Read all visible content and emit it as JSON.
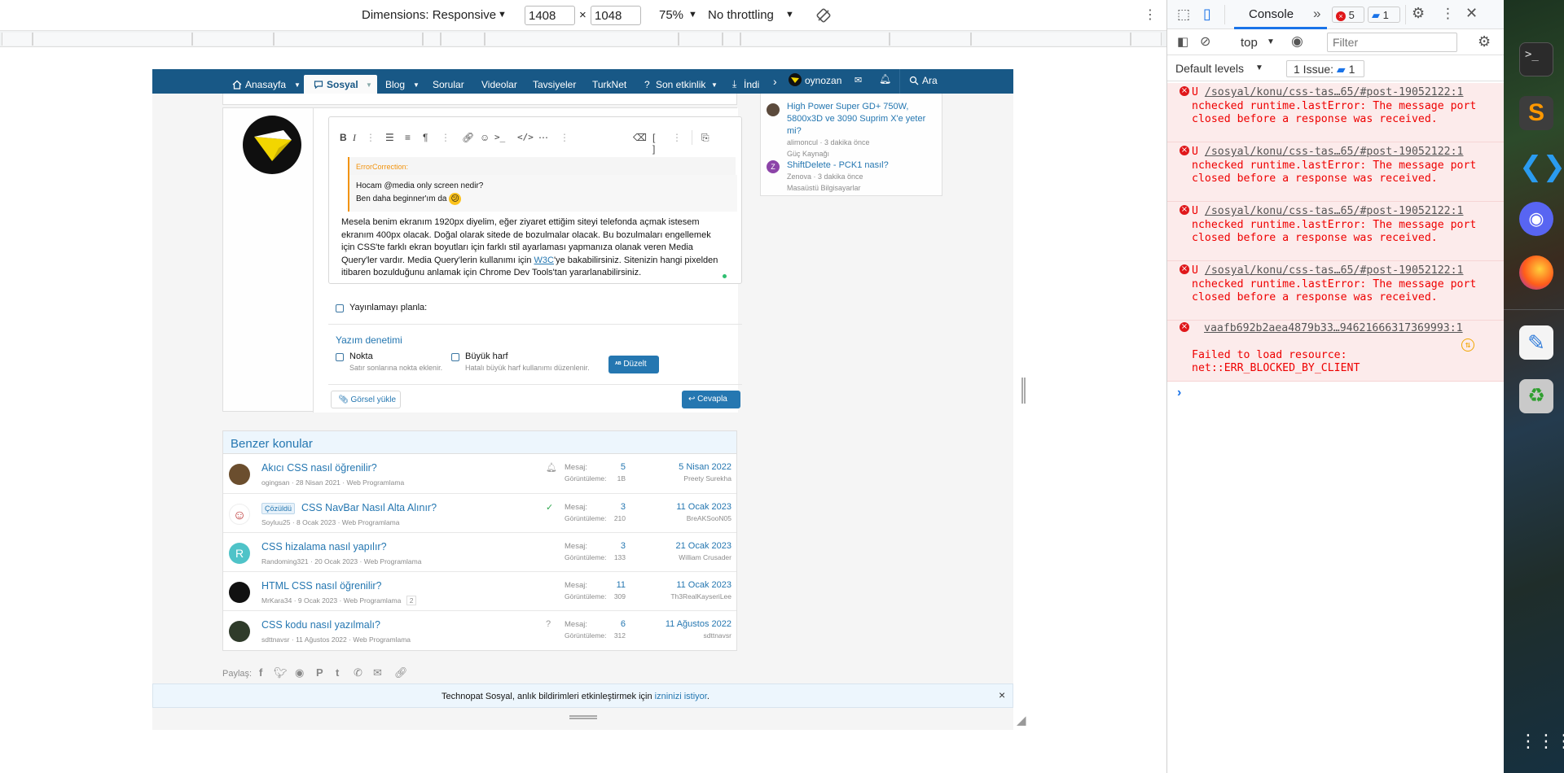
{
  "device_toolbar": {
    "dimensions_label": "Dimensions: Responsive",
    "width": "1408",
    "height": "1048",
    "times": "×",
    "zoom": "75%",
    "throttling": "No throttling"
  },
  "site_nav": {
    "items": [
      "Anasayfa",
      "Sosyal",
      "Blog",
      "Sorular",
      "Videolar",
      "Tavsiyeler",
      "TurkNet",
      "Son etkinlik",
      "İndir"
    ],
    "user": "oynozan",
    "search": "Ara"
  },
  "sidebar_threads": [
    {
      "title": "High Power Super GD+ 750W, 5800x3D ve 3090 Suprim X'e yeter mi?",
      "meta": "alimoncul · 3 dakika önce",
      "forum": "Güç Kaynağı"
    },
    {
      "title": "ShiftDelete - PCK1 nasıl?",
      "meta": "Zenova · 3 dakika önce",
      "forum": "Masaüstü Bilgisayarlar",
      "avatar_letter": "Z"
    }
  ],
  "editor": {
    "quote_author": "ErrorCorrection:",
    "quote_line1": "Hocam @media only screen nedir?",
    "quote_line2": "Ben daha beginner'ım da",
    "body_line1": "Mesela benim ekranım 1920px diyelim, eğer ziyaret ettiğim siteyi telefonda açmak istesem",
    "body_line2": "ekranım 400px olacak. Doğal olarak sitede de bozulmalar olacak. Bu bozulmaları engellemek",
    "body_line3": "için CSS'te farklı ekran boyutları için farklı stil ayarlaması yapmanıza olanak veren Media",
    "body_line4a": "Query'ler vardır. Media Query'lerin kullanımı için ",
    "body_line4_link": "W3C",
    "body_line4b": "'ye bakabilirsiniz. Sitenizin hangi pixelden",
    "body_line5": "itibaren bozulduğunu anlamak için Chrome Dev Tools'tan yararlanabilirsiniz.",
    "schedule_label": "Yayınlamayı planla:",
    "spell_title": "Yazım denetimi",
    "opt1_label": "Nokta",
    "opt1_hint": "Satır sonlarına nokta eklenir.",
    "opt2_label": "Büyük harf",
    "opt2_hint": "Hatalı büyük harf kullanımı düzenlenir.",
    "fix_button": "Düzelt",
    "upload_button": "Görsel yükle",
    "reply_button": "Cevapla"
  },
  "similar": {
    "title": "Benzer konular",
    "rows": [
      {
        "title": "Akıcı CSS nasıl öğrenilir?",
        "author": "ogingsan",
        "date": "28 Nisan 2021",
        "forum": "Web Programlama",
        "msg_label": "Mesaj:",
        "msg": "5",
        "views_label": "Görüntüleme:",
        "views": "1B",
        "last_date": "5 Nisan 2022",
        "last_user": "Preety Surekha"
      },
      {
        "badge": "Çözüldü",
        "title": "CSS NavBar Nasıl Alta Alınır?",
        "author": "Soyluu25",
        "date": "8 Ocak 2023",
        "forum": "Web Programlama",
        "msg_label": "Mesaj:",
        "msg": "3",
        "views_label": "Görüntüleme:",
        "views": "210",
        "last_date": "11 Ocak 2023",
        "last_user": "BreAKSooN05"
      },
      {
        "title": "CSS hizalama nasıl yapılır?",
        "author": "Randoming321",
        "date": "20 Ocak 2023",
        "forum": "Web Programlama",
        "msg_label": "Mesaj:",
        "msg": "3",
        "views_label": "Görüntüleme:",
        "views": "133",
        "last_date": "21 Ocak 2023",
        "last_user": "William Crusader",
        "avatar_letter": "R"
      },
      {
        "title": "HTML CSS nasıl öğrenilir?",
        "author": "MrKara34",
        "date": "9 Ocak 2023",
        "forum": "Web Programlama",
        "pages": "2",
        "msg_label": "Mesaj:",
        "msg": "11",
        "views_label": "Görüntüleme:",
        "views": "309",
        "last_date": "11 Ocak 2023",
        "last_user": "Th3RealKayseriLee"
      },
      {
        "title": "CSS kodu nasıl yazılmalı?",
        "author": "sdttnavsr",
        "date": "11 Ağustos 2022",
        "forum": "Web Programlama",
        "msg_label": "Mesaj:",
        "msg": "6",
        "views_label": "Görüntüleme:",
        "views": "312",
        "last_date": "11 Ağustos 2022",
        "last_user": "sdttnavsr"
      }
    ]
  },
  "share_label": "Paylaş:",
  "notification": {
    "text_a": "Technopat Sosyal, anlık bildirimleri etkinleştirmek için ",
    "link": "izninizi istiyor",
    "text_b": "."
  },
  "devtools": {
    "tab": "Console",
    "error_count": "5",
    "issue_count": "1",
    "context": "top",
    "filter_placeholder": "Filter",
    "levels": "Default levels",
    "issues_label": "1 Issue:",
    "issues_num": "1",
    "messages": [
      {
        "prefix": "U ",
        "link": "/sosyal/konu/css-tas…65/#post-19052122:1",
        "text": "nchecked runtime.lastError: The message port closed before a response was received."
      },
      {
        "prefix": "U ",
        "link": "/sosyal/konu/css-tas…65/#post-19052122:1",
        "text": "nchecked runtime.lastError: The message port closed before a response was received."
      },
      {
        "prefix": "U ",
        "link": "/sosyal/konu/css-tas…65/#post-19052122:1",
        "text": "nchecked runtime.lastError: The message port closed before a response was received."
      },
      {
        "prefix": "U ",
        "link": "/sosyal/konu/css-tas…65/#post-19052122:1",
        "text": "nchecked runtime.lastError: The message port closed before a response was received."
      }
    ],
    "resource_error": {
      "link": "vaafb692b2aea4879b33…94621666317369993:1",
      "line1": "Failed to load resource:",
      "line2": "net::ERR_BLOCKED_BY_CLIENT"
    },
    "prompt": "›"
  },
  "colors": {
    "site_nav": "#185886",
    "link": "#2577b1",
    "error_bg": "#fcebeb",
    "error_text": "#e00"
  }
}
